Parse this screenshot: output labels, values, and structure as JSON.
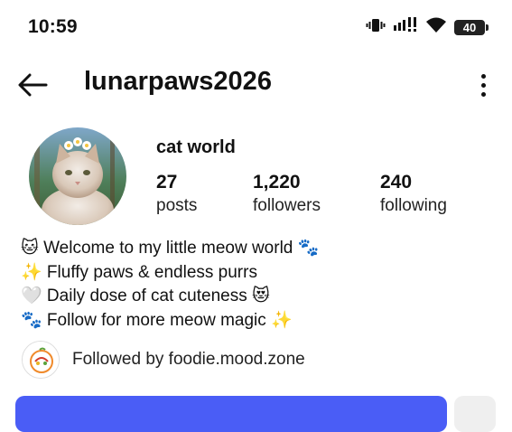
{
  "status_bar": {
    "time": "10:59",
    "battery_level": "40"
  },
  "header": {
    "username": "lunarpaws2026"
  },
  "profile": {
    "display_name": "cat world",
    "stats": {
      "posts": {
        "value": "27",
        "label": "posts"
      },
      "followers": {
        "value": "1,220",
        "label": "followers"
      },
      "following": {
        "value": "240",
        "label": "following"
      }
    },
    "bio": [
      "🐱 Welcome to my little meow world 🐾",
      "✨ Fluffy paws & endless purrs",
      "🤍 Daily dose of cat cuteness 😻",
      "🐾 Follow for more meow magic ✨"
    ],
    "followed_by": {
      "prefix": "Followed by ",
      "account": "foodie.mood.zone"
    }
  },
  "colors": {
    "primary_button": "#4a5df6",
    "secondary_button": "#efefef"
  },
  "icons": {
    "back": "arrow-left-icon",
    "more": "more-vertical-icon",
    "vibrate": "vibrate-icon",
    "signal": "signal-icon",
    "wifi": "wifi-icon",
    "battery": "battery-icon"
  }
}
